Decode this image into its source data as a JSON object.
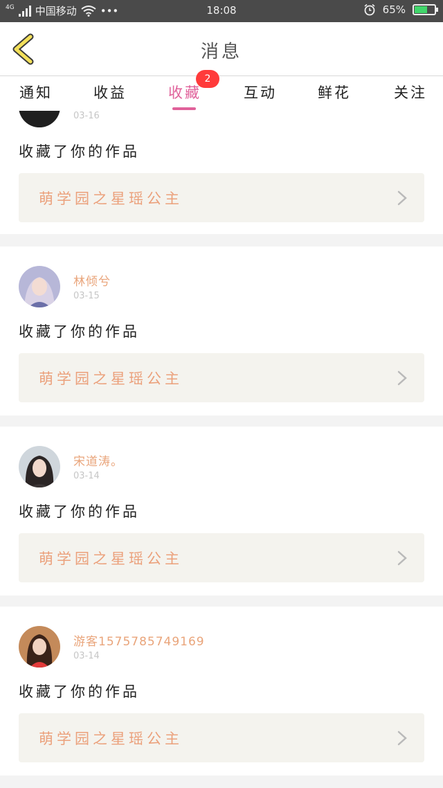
{
  "status_bar": {
    "network": "4G",
    "carrier": "中国移动",
    "more": "•••",
    "time": "18:08",
    "battery_percent_text": "65%",
    "battery_level": 0.65
  },
  "header": {
    "title": "消息"
  },
  "tabs": {
    "items": [
      {
        "label": "通知"
      },
      {
        "label": "收益"
      },
      {
        "label": "收藏"
      },
      {
        "label": "互动"
      },
      {
        "label": "鲜花"
      },
      {
        "label": "关注"
      }
    ],
    "active_index": 2,
    "badge": "2"
  },
  "feed": {
    "items": [
      {
        "username": "",
        "date": "03-16",
        "action": "收藏了你的作品",
        "work_title": "萌学园之星瑶公主"
      },
      {
        "username": "林倾兮",
        "date": "03-15",
        "action": "收藏了你的作品",
        "work_title": "萌学园之星瑶公主"
      },
      {
        "username": "宋道涛。",
        "date": "03-14",
        "action": "收藏了你的作品",
        "work_title": "萌学园之星瑶公主"
      },
      {
        "username": "游客1575785749169",
        "date": "03-14",
        "action": "收藏了你的作品",
        "work_title": "萌学园之星瑶公主"
      }
    ]
  },
  "colors": {
    "accent_pink": "#e0619a",
    "name_orange": "#e9a47a",
    "badge_red": "#ff3b3b",
    "back_arrow_yellow": "#f3e05a"
  }
}
